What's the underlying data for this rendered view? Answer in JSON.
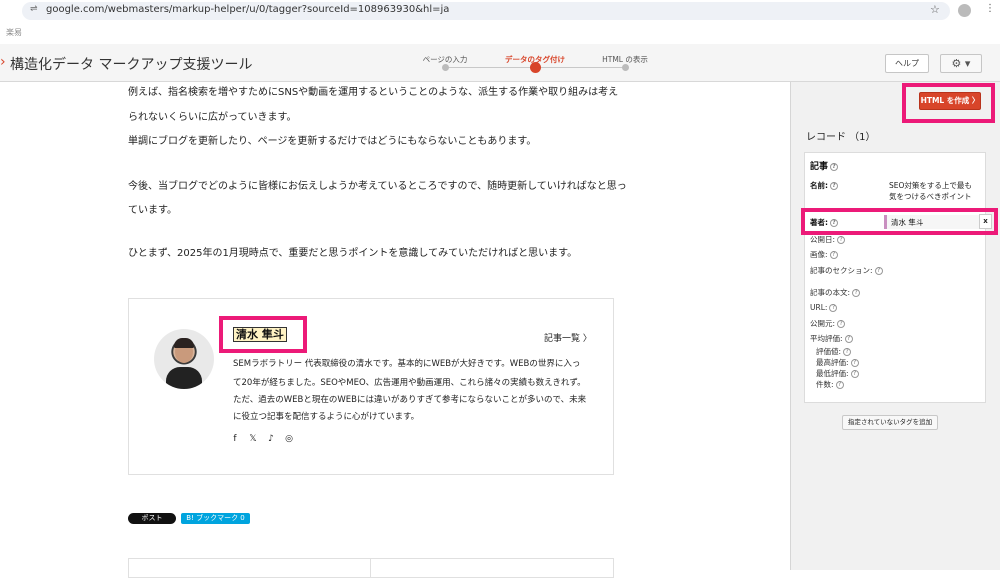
{
  "browser": {
    "url": "google.com/webmasters/markup-helper/u/0/tagger?sourceId=108963930&hl=ja",
    "bookmark": "楽易"
  },
  "app": {
    "title": "構造化データ マークアップ支援ツール",
    "steps": [
      {
        "label": "ページの入力",
        "active": false
      },
      {
        "label": "データのタグ付け",
        "active": true
      },
      {
        "label": "HTML の表示",
        "active": false
      }
    ],
    "help_label": "ヘルプ",
    "gear_label": "⚙ ▾"
  },
  "article": {
    "paragraphs": [
      "例えば、指名検索を増やすためにSNSや動画を運用するということのような、派生する作業や取り組みは考え",
      "られないくらいに広がっていきます。",
      "単調にブログを更新したり、ページを更新するだけではどうにもならないこともあります。",
      "今後、当ブログでどのように皆様にお伝えしようか考えているところですので、随時更新していければなと思っ",
      "ています。",
      "ひとまず、2025年の1月現時点で、重要だと思うポイントを意識してみていただければと思います。"
    ],
    "author": {
      "name": "清水 隼斗",
      "list_link": "記事一覧 〉",
      "bio": [
        "SEMラボラトリー 代表取締役の清水です。基本的にWEBが大好きです。WEBの世界に入っ",
        "て20年が経ちました。SEOやMEO、広告運用や動画運用、これら諸々の実績も数えきれず。",
        "ただ、過去のWEBと現在のWEBには違いがありすぎて参考にならないことが多いので、未来",
        "に役立つ記事を配信するように心がけています。"
      ],
      "social": [
        "f",
        "𝕏",
        "♪",
        "◎"
      ]
    },
    "share": {
      "post_label": "ポスト",
      "hatena_label": "B! ブックマーク  0"
    }
  },
  "panel": {
    "html_button": "HTML を作成 〉",
    "record_heading": "レコード （1）",
    "record_type": "記事",
    "fields": [
      {
        "label": "名前:",
        "bold": true
      },
      {
        "label": "著者:",
        "bold": true
      },
      {
        "label": "公開日:",
        "bold": false
      },
      {
        "label": "画像:",
        "bold": false
      },
      {
        "label": "記事のセクション:",
        "bold": false
      },
      {
        "label": "記事の本文:",
        "bold": false
      },
      {
        "label": "URL:",
        "bold": false
      },
      {
        "label": "公開元:",
        "bold": false
      },
      {
        "label": "平均評価:",
        "bold": false
      }
    ],
    "rating_subfields": [
      "評価値:",
      "最高評価:",
      "最低評価:",
      "件数:"
    ],
    "headline_value": "SEO対策をする上で最も気をつけるべきポイント",
    "author_value": "清水 隼斗",
    "remove_label": "x",
    "add_tag_button": "指定されていないタグを追加"
  },
  "colors": {
    "accent": "#d8452a",
    "highlight_box": "#ec1a78",
    "hatena": "#00a4de"
  }
}
